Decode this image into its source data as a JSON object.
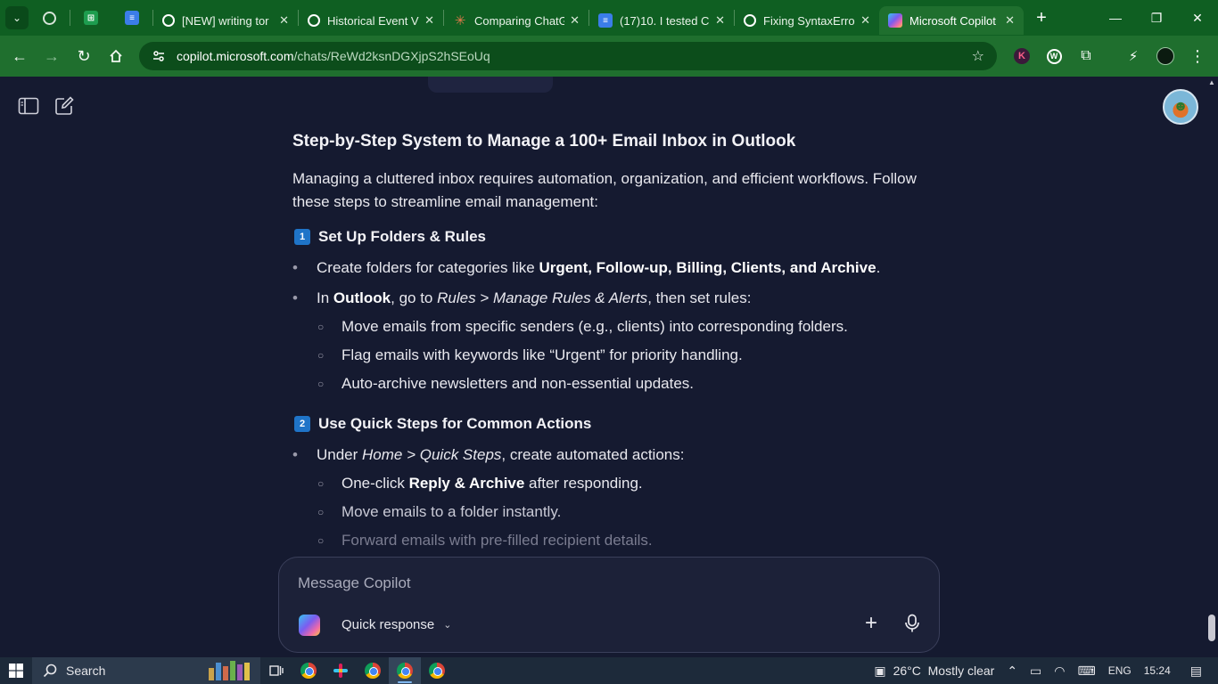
{
  "browser": {
    "tabs": [
      {
        "title": "[NEW] writing tor",
        "icon": "openai-icon"
      },
      {
        "title": "Historical Event V",
        "icon": "openai-icon"
      },
      {
        "title": "Comparing ChatG",
        "icon": "claude-icon"
      },
      {
        "title": "(17)10. I tested C",
        "icon": "docs-icon"
      },
      {
        "title": "Fixing SyntaxErro",
        "icon": "openai-icon"
      },
      {
        "title": "Microsoft Copilot",
        "icon": "copilot-icon"
      }
    ],
    "url_host": "copilot.microsoft.com",
    "url_path": "/chats/ReWd2ksnDGXjpS2hSEoUq",
    "ext_k_label": "K"
  },
  "article": {
    "heading": "Step-by-Step System to Manage a 100+ Email Inbox in Outlook",
    "intro": "Managing a cluttered inbox requires automation, organization, and efficient workflows. Follow these steps to streamline email management:",
    "step1": {
      "num": "1",
      "title": "Set Up Folders & Rules",
      "b1_pre": "Create folders for categories like ",
      "b1_bold": "Urgent, Follow-up, Billing, Clients, and Archive",
      "b1_post": ".",
      "b2_pre": "In ",
      "b2_bold": "Outlook",
      "b2_mid": ", go to ",
      "b2_italic": "Rules > Manage Rules & Alerts",
      "b2_post": ", then set rules:",
      "subs": [
        "Move emails from specific senders (e.g., clients) into corresponding folders.",
        "Flag emails with keywords like “Urgent” for priority handling.",
        "Auto-archive newsletters and non-essential updates."
      ]
    },
    "step2": {
      "num": "2",
      "title": "Use Quick Steps for Common Actions",
      "b1_pre": "Under ",
      "b1_italic": "Home > Quick Steps",
      "b1_post": ", create automated actions:",
      "s1_pre": "One-click ",
      "s1_bold": "Reply & Archive",
      "s1_post": " after responding.",
      "s2": "Move emails to a folder instantly.",
      "s3": "Forward emails with pre-filled recipient details."
    }
  },
  "composer": {
    "placeholder": "Message Copilot",
    "mode": "Quick response"
  },
  "taskbar": {
    "search": "Search",
    "weather": "26°C  Mostly clear",
    "lang": "ENG",
    "time": "15:24"
  }
}
